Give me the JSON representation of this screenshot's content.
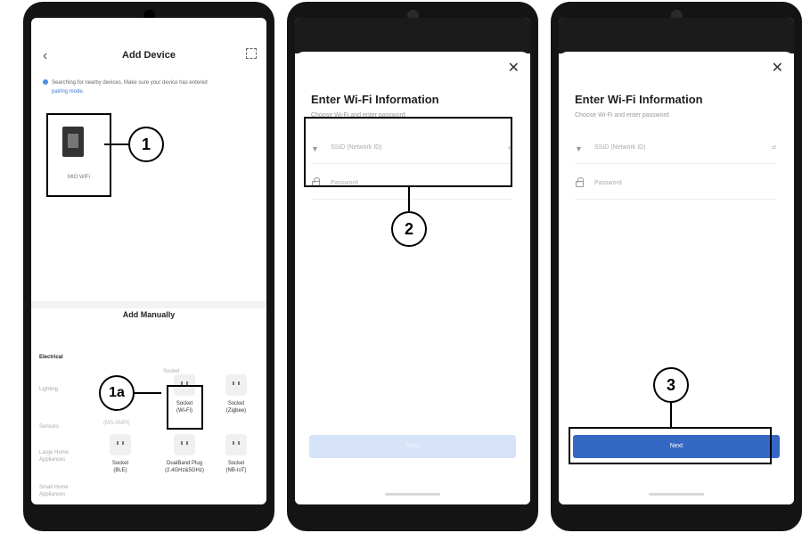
{
  "screen1": {
    "back_icon": "chevron-left-icon",
    "title": "Add Device",
    "scan_icon": "scan-icon",
    "notice_text": "Searching for nearby devices. Make sure your device has entered",
    "notice_link": "pairing mode.",
    "found_device_name": "MIO WiFi",
    "add_manually": "Add Manually",
    "category_heading": "Socket",
    "categories": [
      {
        "label": "Electrical",
        "active": true
      },
      {
        "label": "Lighting",
        "active": false
      },
      {
        "label": "Sensors",
        "active": false
      },
      {
        "label": "Large Home Appliances",
        "active": false
      },
      {
        "label": "Small Home Appliances",
        "active": false
      }
    ],
    "tiles": [
      {
        "label": "Socket\n(Wi-Fi)"
      },
      {
        "label": "Socket\n(Zigbee)"
      },
      {
        "label": "Socket\n(BLE)"
      },
      {
        "label": "DualBand Plug\n(2.4GHz&5GHz)"
      },
      {
        "label": "Socket\n(NB-IoT)"
      }
    ],
    "ghost_label": "(MS-SMPI)"
  },
  "wifi_form": {
    "close_icon": "close-icon",
    "title": "Enter Wi-Fi Information",
    "subtitle": "Choose Wi-Fi and enter password",
    "ssid_placeholder": "SSID (Network ID)",
    "ssid_switch": "⇄",
    "password_placeholder": "Password",
    "next_label": "Next"
  },
  "callouts": {
    "c1": "1",
    "c1a": "1a",
    "c2": "2",
    "c3": "3"
  },
  "colors": {
    "accent": "#3468c4",
    "disabled_button": "#d6e3f8",
    "phone_frame": "#141414"
  }
}
